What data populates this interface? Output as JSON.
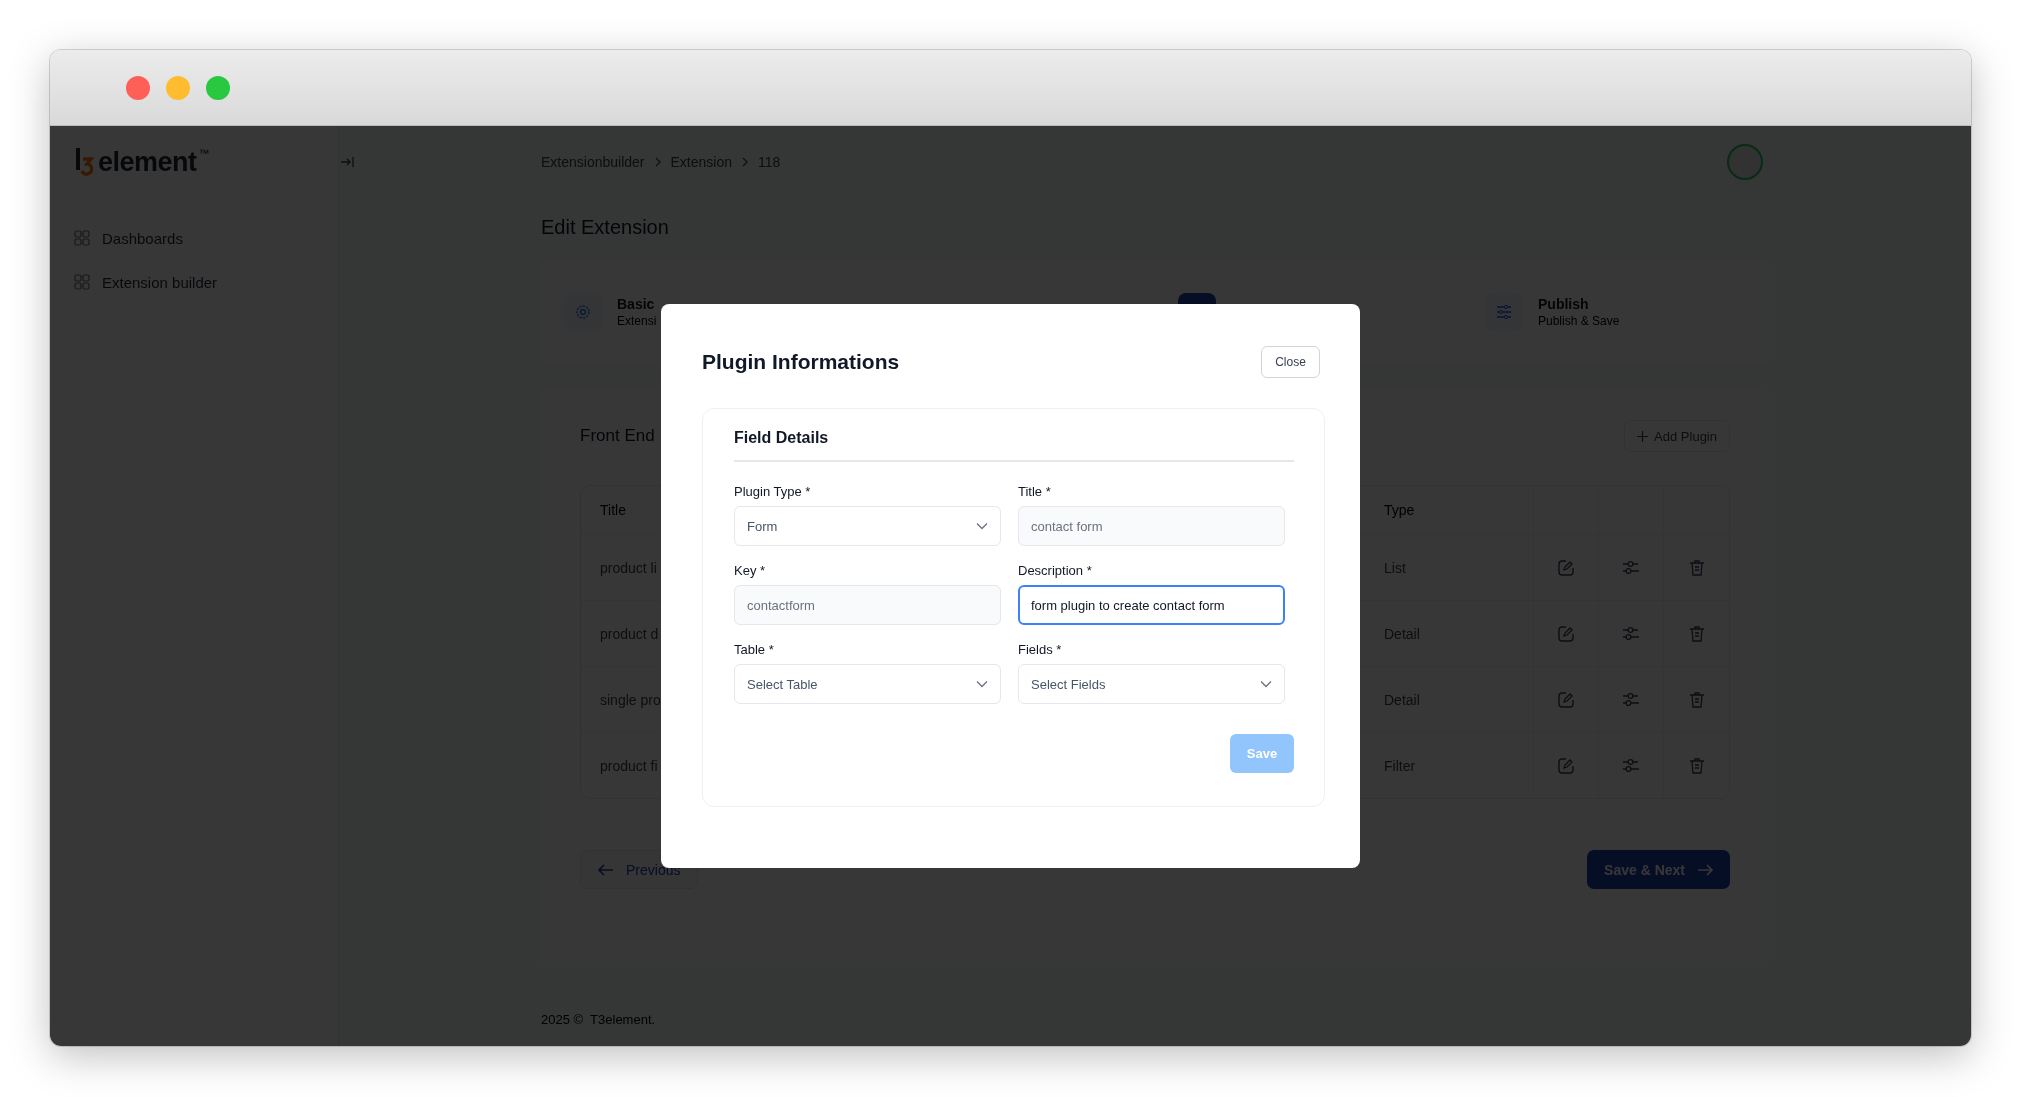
{
  "sidebar": {
    "logo": {
      "text": "element",
      "mark": "™"
    },
    "items": [
      {
        "label": "Dashboards"
      },
      {
        "label": "Extension builder"
      }
    ]
  },
  "breadcrumb": [
    "Extensionbuilder",
    "Extension",
    "118"
  ],
  "page_title": "Edit Extension",
  "stepper": [
    {
      "kind": "settings",
      "title": "Basic",
      "subtitle": "Extensi",
      "selected": false
    },
    {
      "kind": "current",
      "selected": true
    },
    {
      "kind": "publish",
      "title": "Publish",
      "subtitle": "Publish & Save",
      "selected": false
    }
  ],
  "section": {
    "heading": "Front End",
    "add_button": "Add Plugin"
  },
  "table": {
    "columns": [
      "Title",
      "Type"
    ],
    "rows": [
      {
        "title": "product li",
        "type": "List"
      },
      {
        "title": "product d",
        "type": "Detail"
      },
      {
        "title": "single pro",
        "type": "Detail"
      },
      {
        "title": "product fi",
        "type": "Filter"
      }
    ]
  },
  "nav": {
    "previous": "Previous",
    "next": "Save & Next"
  },
  "footer": "2025 ©  T3element.",
  "modal": {
    "title": "Plugin Informations",
    "close": "Close",
    "section": "Field Details",
    "fields": [
      {
        "label": "Plugin Type *",
        "kind": "select",
        "value": "Form",
        "disabled": false,
        "focused": false
      },
      {
        "label": "Title *",
        "kind": "input",
        "value": "contact form",
        "disabled": true,
        "focused": false
      },
      {
        "label": "Key *",
        "kind": "input",
        "value": "contactform",
        "disabled": true,
        "focused": false
      },
      {
        "label": "Description *",
        "kind": "input",
        "value": "form plugin to create contact form",
        "disabled": false,
        "focused": true
      },
      {
        "label": "Table *",
        "kind": "select",
        "placeholder": "Select Table",
        "disabled": false,
        "focused": false
      },
      {
        "label": "Fields *",
        "kind": "select",
        "placeholder": "Select Fields",
        "disabled": false,
        "focused": false
      }
    ],
    "save": {
      "label": "Save",
      "disabled": true
    }
  }
}
